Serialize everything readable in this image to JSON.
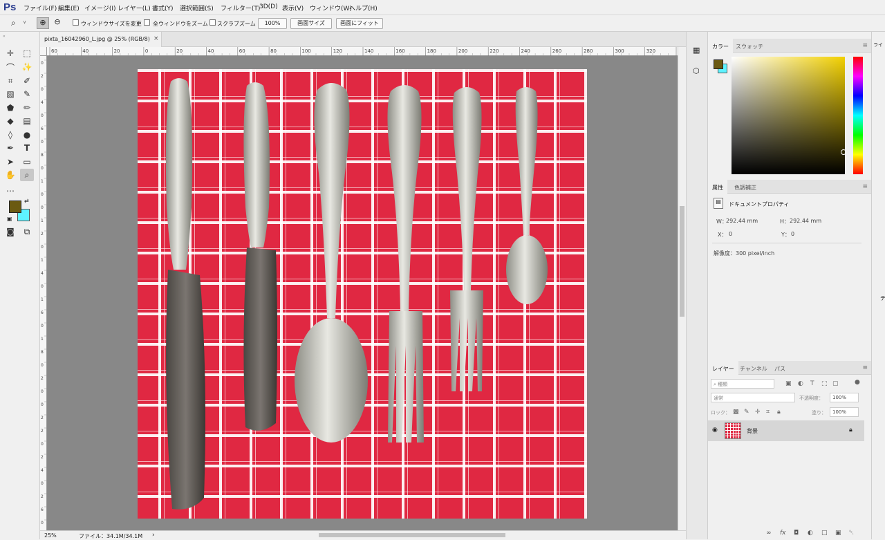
{
  "app": {
    "logo": "Ps"
  },
  "menu": [
    "ファイル(F)",
    "編集(E)",
    "イメージ(I)",
    "レイヤー(L)",
    "書式(Y)",
    "選択範囲(S)",
    "フィルター(T)",
    "3D(D)",
    "表示(V)",
    "ウィンドウ(W)",
    "ヘルプ(H)"
  ],
  "options": {
    "resize_windows": "ウィンドウサイズを変更",
    "zoom_all": "全ウィンドウをズーム",
    "scrubby_zoom": "スクラブズーム",
    "zoom_value": "100%",
    "fit_screen": "画面サイズ",
    "fill_screen": "画面にフィット"
  },
  "document": {
    "tab_title": "pixta_16042960_L.jpg @ 25% (RGB/8)",
    "close": "×",
    "ruler_top_labels": [
      "60",
      "40",
      "20",
      "0",
      "20",
      "40",
      "60",
      "80",
      "100",
      "120",
      "140",
      "160",
      "180",
      "200",
      "220",
      "240",
      "260",
      "280",
      "300",
      "320",
      "340"
    ],
    "ruler_left_labels": [
      "0",
      "2",
      "0",
      "4",
      "0",
      "6",
      "0",
      "8",
      "0",
      "1",
      "0",
      "0",
      "1",
      "2",
      "0",
      "1",
      "4",
      "0",
      "1",
      "6",
      "0",
      "1",
      "8",
      "0",
      "2",
      "0",
      "0",
      "2",
      "2",
      "0",
      "2",
      "4",
      "0",
      "2",
      "6",
      "0"
    ]
  },
  "status": {
    "zoom": "25%",
    "file_info": "ファイル：34.1M/34.1M",
    "arrow": "›"
  },
  "colors": {
    "foreground": "#6b5a12",
    "background": "#5ef3ff",
    "canvas_bg": "#888888",
    "cloth_red": "#e02842"
  },
  "color_panel": {
    "tab_color": "カラー",
    "tab_swatch": "スウォッチ"
  },
  "properties_panel": {
    "tab_properties": "属性",
    "tab_adjust": "色調補正",
    "doc_title": "ドキュメントプロパティ",
    "w_label": "W：",
    "w_value": "292.44 mm",
    "h_label": "H：",
    "h_value": "292.44 mm",
    "x_label": "X：",
    "x_value": "0",
    "y_label": "Y：",
    "y_value": "0",
    "resolution": "解像度：300 pixel/inch"
  },
  "layers_panel": {
    "tab_layers": "レイヤー",
    "tab_channels": "チャンネル",
    "tab_paths": "パス",
    "filter_kind": "種類",
    "blend_mode": "通常",
    "opacity_label": "不透明度：",
    "opacity_value": "100%",
    "lock_label": "ロック：",
    "fill_label": "塗り：",
    "fill_value": "100%",
    "layer_name": "背景"
  },
  "far_right": {
    "tab_partial": "ライ",
    "label_partial": "テ"
  }
}
